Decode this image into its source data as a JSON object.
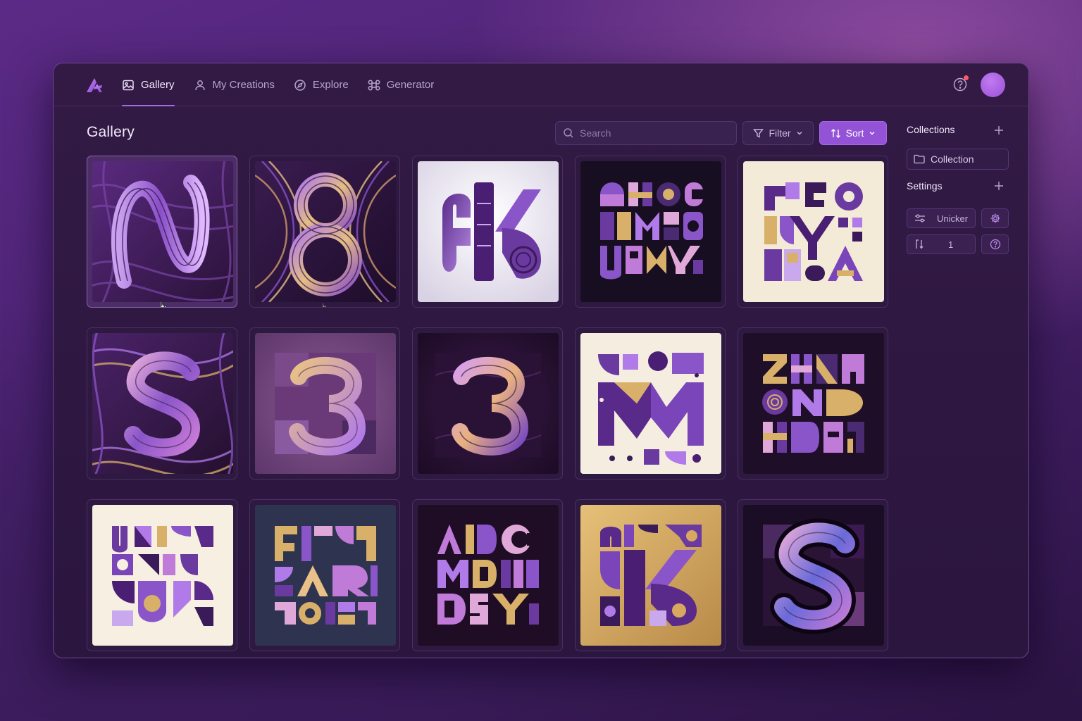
{
  "app": {
    "logo": "monogram-a-logo"
  },
  "nav": {
    "items": [
      {
        "label": "Gallery",
        "icon": "image-icon",
        "active": true
      },
      {
        "label": "My Creations",
        "icon": "user-icon",
        "active": false
      },
      {
        "label": "Explore",
        "icon": "compass-icon",
        "active": false
      },
      {
        "label": "Generator",
        "icon": "command-icon",
        "active": false
      }
    ]
  },
  "header": {
    "help_icon": "help-icon",
    "notification": true
  },
  "main": {
    "title": "Gallery",
    "search": {
      "placeholder": "Search",
      "value": ""
    },
    "filter_label": "Filter",
    "sort_label": "Sort"
  },
  "sidebar": {
    "collections_title": "Collections",
    "collection_item": "Collection",
    "settings_title": "Settings",
    "setting_1": "Unicker",
    "setting_2": "1"
  },
  "gallery": {
    "tiles": [
      {
        "glyph": "N",
        "style": "swirl",
        "selected": true
      },
      {
        "glyph": "8",
        "style": "swirl"
      },
      {
        "glyph": "K",
        "style": "light-geo"
      },
      {
        "glyph": "AHMY",
        "style": "dark-mosaic"
      },
      {
        "glyph": "YA",
        "style": "cream-mosaic"
      },
      {
        "glyph": "S",
        "style": "swirl"
      },
      {
        "glyph": "3",
        "style": "mauve"
      },
      {
        "glyph": "3",
        "style": "dark"
      },
      {
        "glyph": "M",
        "style": "cream-geo"
      },
      {
        "glyph": "ZHND",
        "style": "dark-mosaic"
      },
      {
        "glyph": "UJ",
        "style": "cream-geo"
      },
      {
        "glyph": "FAR",
        "style": "navy-mosaic"
      },
      {
        "glyph": "AbCMD",
        "style": "dark-mosaic"
      },
      {
        "glyph": "K",
        "style": "gold"
      },
      {
        "glyph": "S",
        "style": "dark"
      }
    ]
  },
  "colors": {
    "accent": "#9452d6",
    "background": "#2b1640",
    "gold": "#d8b06a"
  }
}
